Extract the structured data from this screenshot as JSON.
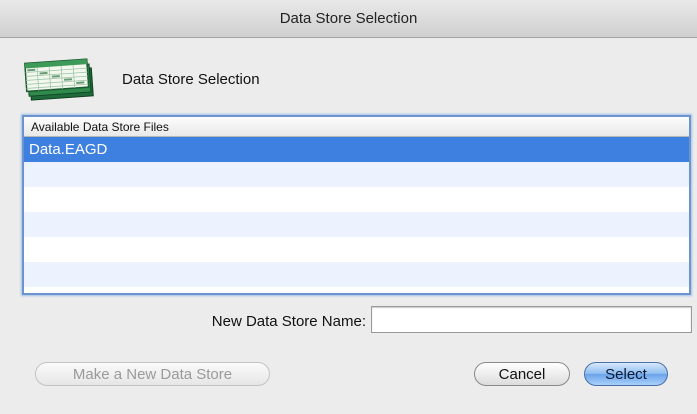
{
  "window": {
    "title": "Data Store Selection"
  },
  "header": {
    "title": "Data Store Selection",
    "icon": "spreadsheet-stack-icon"
  },
  "list": {
    "column_header": "Available Data Store Files",
    "items": [
      "Data.EAGD",
      "",
      "",
      "",
      "",
      "",
      ""
    ],
    "selected_index": 0
  },
  "form": {
    "new_name_label": "New Data Store Name:",
    "new_name_value": "",
    "new_name_placeholder": ""
  },
  "buttons": {
    "make_new": "Make a New Data Store",
    "cancel": "Cancel",
    "select": "Select"
  },
  "colors": {
    "selection": "#3d80df",
    "alt_row": "#edf3fe",
    "focus_ring": "#6c95cf",
    "default_button": "#8dbbf0"
  }
}
